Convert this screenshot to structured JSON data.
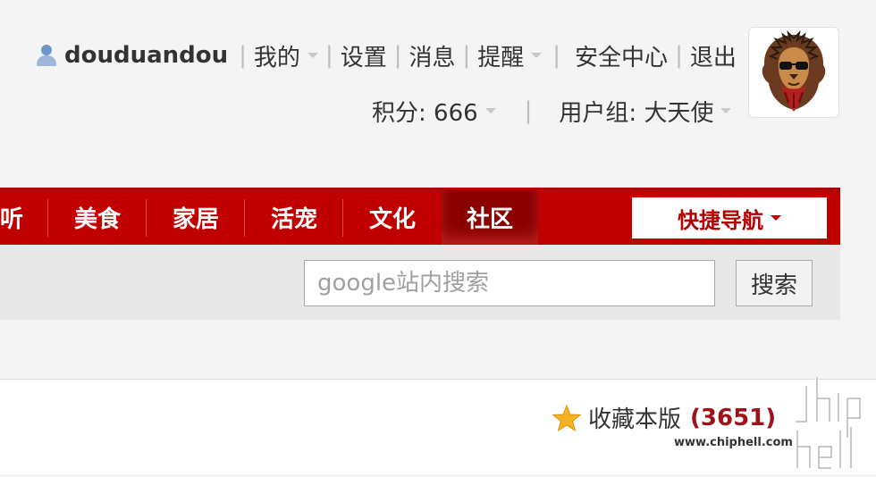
{
  "user": {
    "username": "douduandou",
    "links": [
      {
        "label": "我的",
        "dropdown": true
      },
      {
        "label": "设置",
        "dropdown": false
      },
      {
        "label": "消息",
        "dropdown": false
      },
      {
        "label": "提醒",
        "dropdown": true
      },
      {
        "label": "安全中心",
        "dropdown": false
      },
      {
        "label": "退出",
        "dropdown": false
      }
    ],
    "points_label": "积分: 666",
    "group_label": "用户组: 大天使",
    "separator": "|",
    "avatar_icon": "lion-avatar-icon"
  },
  "nav": {
    "items": [
      {
        "label": "听"
      },
      {
        "label": "美食"
      },
      {
        "label": "家居"
      },
      {
        "label": "活宠"
      },
      {
        "label": "文化"
      },
      {
        "label": "社区",
        "active": true
      }
    ],
    "quick_nav_label": "快捷导航",
    "colors": {
      "bar": "#c00000",
      "active": "#8a0000",
      "quick_nav_text": "#b40000"
    }
  },
  "search": {
    "placeholder": "google站内搜索",
    "value": "",
    "button_label": "搜索"
  },
  "forum": {
    "favorite_label": "收藏本版",
    "favorite_count": "(3651)",
    "favorite_icon": "star-icon"
  },
  "watermark": {
    "logo_text": "chiphell",
    "url": "www.chiphell.com"
  }
}
